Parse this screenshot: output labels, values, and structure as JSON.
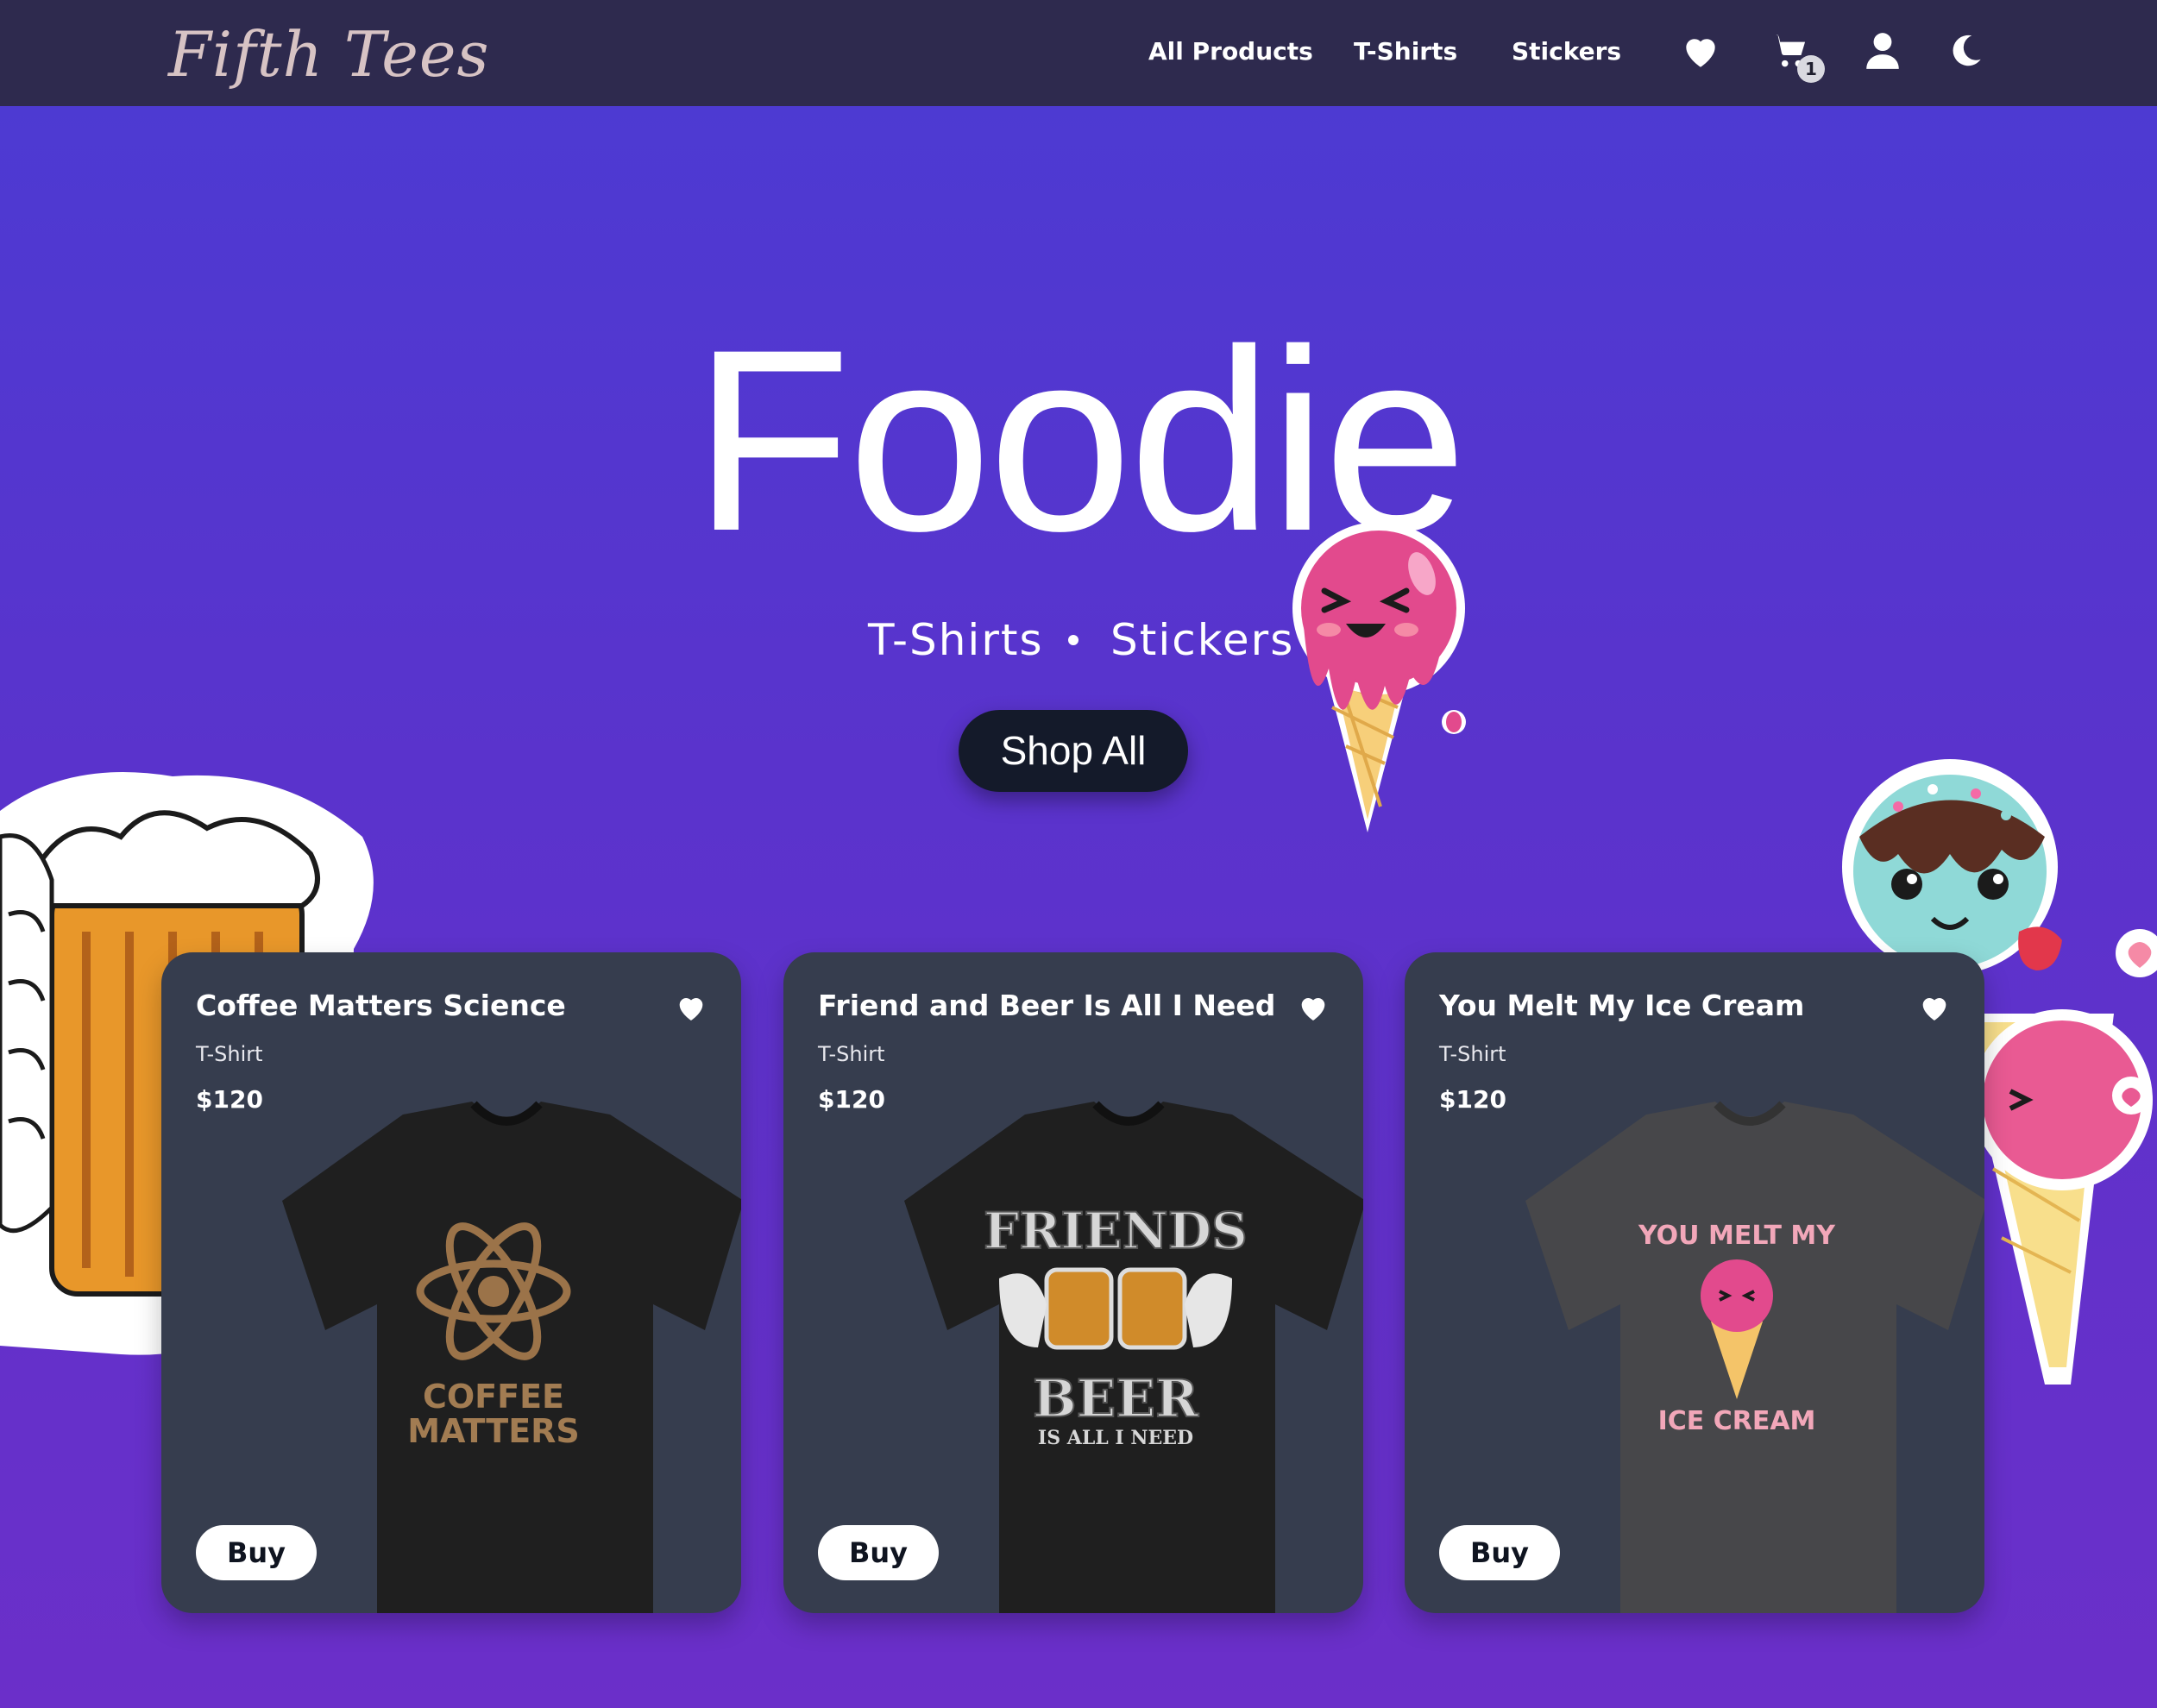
{
  "nav": {
    "logo": "Fifth Tees",
    "links": [
      "All Products",
      "T-Shirts",
      "Stickers"
    ],
    "icons": [
      "heart-icon",
      "cart-icon",
      "user-icon",
      "moon-icon"
    ],
    "cart_count": "1"
  },
  "hero": {
    "title": "Foodie",
    "subtitle_left": "T-Shirts",
    "subtitle_right": "Stickers",
    "cta": "Shop All"
  },
  "products": [
    {
      "name": "Coffee Matters Science",
      "type": "T-Shirt",
      "price": "$120",
      "buy_label": "Buy",
      "print_text": [
        "COFFEE",
        "MATTERS"
      ]
    },
    {
      "name": "Friend and Beer Is All I Need",
      "type": "T-Shirt",
      "price": "$120",
      "buy_label": "Buy",
      "print_text": [
        "FRIENDS",
        "BEER",
        "IS ALL I NEED"
      ]
    },
    {
      "name": "You Melt My Ice Cream",
      "type": "T-Shirt",
      "price": "$120",
      "buy_label": "Buy",
      "print_text": [
        "YOU MELT MY",
        "ICE CREAM"
      ]
    }
  ],
  "colors": {
    "nav_bg": "#2e2a4e",
    "hero_gradient_top": "#4b3bd3",
    "hero_gradient_bottom": "#6b2fc9",
    "card_bg": "#363d4e",
    "cta_bg": "#141a2a"
  }
}
